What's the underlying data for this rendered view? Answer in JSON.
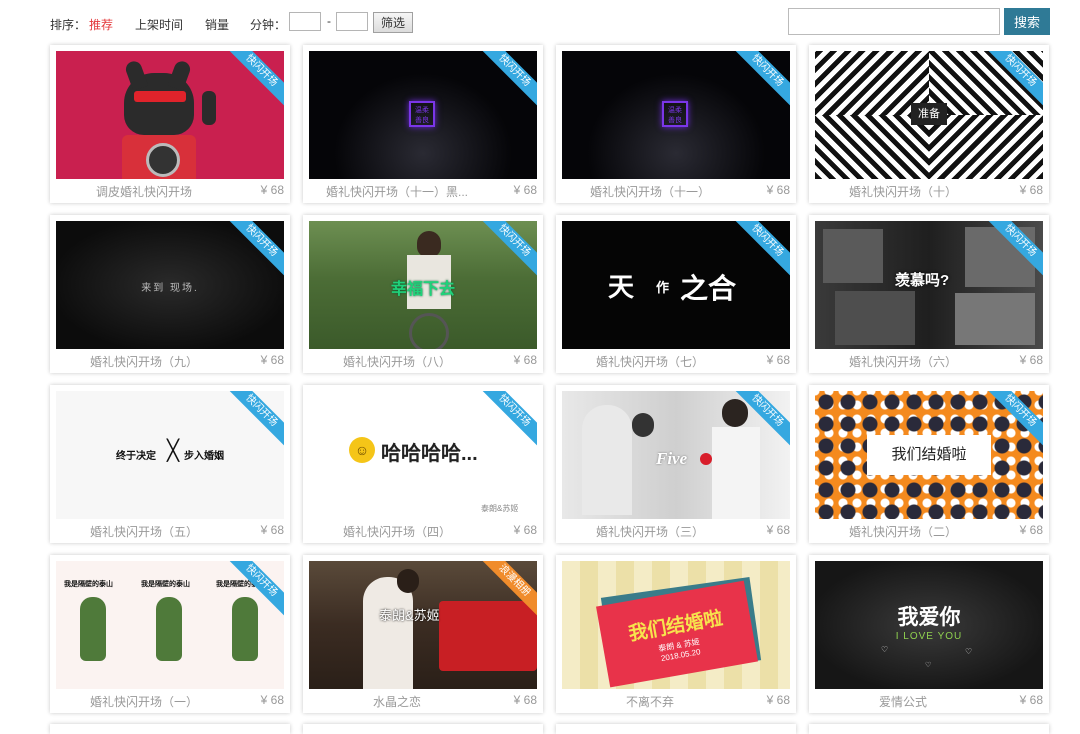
{
  "filter": {
    "sort_label": "排序：",
    "sort_options": [
      "推荐",
      "上架时间",
      "销量"
    ],
    "duration_label": "分钟：",
    "duration_min": "",
    "duration_max": "",
    "dash": "-",
    "filter_button": "筛选",
    "search_value": "",
    "search_button": "搜索"
  },
  "colors": {
    "active_sort": "#e4393c",
    "ribbon_blue": "#35a8e0",
    "ribbon_orange": "#f08c2c",
    "search_button": "#2f7a96"
  },
  "cards": [
    {
      "title": "调皮婚礼快闪开场",
      "price": "¥ 68",
      "ribbon": "快闪开场"
    },
    {
      "title": "婚礼快闪开场（十一）黑...",
      "price": "¥ 68",
      "ribbon": "快闪开场",
      "thumb_text": [
        "温柔",
        "善良"
      ]
    },
    {
      "title": "婚礼快闪开场（十一）",
      "price": "¥ 68",
      "ribbon": "快闪开场",
      "thumb_text": [
        "温柔",
        "善良"
      ]
    },
    {
      "title": "婚礼快闪开场（十）",
      "price": "¥ 68",
      "ribbon": "快闪开场",
      "thumb_text": "准备"
    },
    {
      "title": "婚礼快闪开场（九）",
      "price": "¥ 68",
      "ribbon": "快闪开场",
      "thumb_text": "来到 现场."
    },
    {
      "title": "婚礼快闪开场（八）",
      "price": "¥ 68",
      "ribbon": "快闪开场",
      "thumb_text": "幸福下去"
    },
    {
      "title": "婚礼快闪开场（七）",
      "price": "¥ 68",
      "ribbon": "快闪开场",
      "thumb_text": [
        "天",
        "作",
        "之合"
      ]
    },
    {
      "title": "婚礼快闪开场（六）",
      "price": "¥ 68",
      "ribbon": "快闪开场",
      "thumb_text": "羡慕吗?"
    },
    {
      "title": "婚礼快闪开场（五）",
      "price": "¥ 68",
      "ribbon": "快闪开场",
      "thumb_text": [
        "终于决定",
        "步入婚姻"
      ]
    },
    {
      "title": "婚礼快闪开场（四）",
      "price": "¥ 68",
      "ribbon": "快闪开场",
      "thumb_text": "哈哈哈哈...",
      "thumb_sub": "泰朗&苏姬"
    },
    {
      "title": "婚礼快闪开场（三）",
      "price": "¥ 68",
      "ribbon": "快闪开场",
      "thumb_text": "Five"
    },
    {
      "title": "婚礼快闪开场（二）",
      "price": "¥ 68",
      "ribbon": "快闪开场",
      "thumb_text": "我们结婚啦"
    },
    {
      "title": "婚礼快闪开场（一）",
      "price": "¥ 68",
      "ribbon": "快闪开场",
      "thumb_text": "我是隔壁的泰山"
    },
    {
      "title": "水晶之恋",
      "price": "¥ 68",
      "ribbon": "浪漫相册",
      "thumb_text": "泰朗&苏姬"
    },
    {
      "title": "不离不弃",
      "price": "¥ 68",
      "thumb_text": "我们结婚啦",
      "thumb_sub": "泰朗 & 苏姬",
      "thumb_date": "2018.05.20"
    },
    {
      "title": "爱情公式",
      "price": "¥ 68",
      "thumb_text": "我爱你",
      "thumb_sub": "I LOVE YOU"
    }
  ]
}
